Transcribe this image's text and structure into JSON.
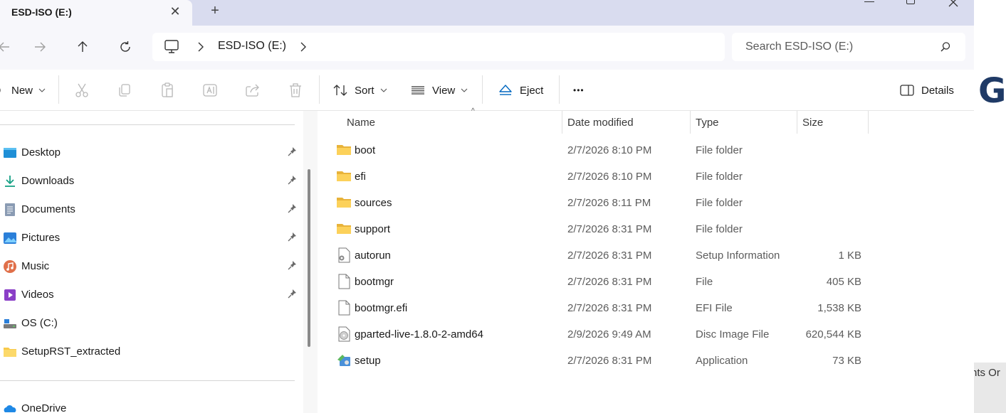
{
  "window": {
    "tab_title": "ESD-ISO (E:)",
    "tab_close": "✕",
    "new_tab": "+"
  },
  "address": {
    "crumb": "ESD-ISO (E:)"
  },
  "search": {
    "placeholder": "Search ESD-ISO (E:)"
  },
  "commands": {
    "new_label": "New",
    "sort_label": "Sort",
    "view_label": "View",
    "eject_label": "Eject",
    "more_label": "•••",
    "details_label": "Details"
  },
  "sidebar": {
    "items": [
      {
        "label": "Desktop",
        "icon": "desktop-icon"
      },
      {
        "label": "Downloads",
        "icon": "downloads-icon"
      },
      {
        "label": "Documents",
        "icon": "documents-icon"
      },
      {
        "label": "Pictures",
        "icon": "pictures-icon"
      },
      {
        "label": "Music",
        "icon": "music-icon"
      },
      {
        "label": "Videos",
        "icon": "videos-icon"
      },
      {
        "label": "OS (C:)",
        "icon": "drive-icon"
      },
      {
        "label": "SetupRST_extracted",
        "icon": "folder-icon"
      },
      {
        "label": "OneDrive",
        "icon": "onedrive-icon"
      }
    ]
  },
  "columns": {
    "name": "Name",
    "date": "Date modified",
    "type": "Type",
    "size": "Size"
  },
  "files": [
    {
      "name": "boot",
      "date": "2/7/2026 8:10 PM",
      "type": "File folder",
      "size": "",
      "icon": "folder-icon"
    },
    {
      "name": "efi",
      "date": "2/7/2026 8:10 PM",
      "type": "File folder",
      "size": "",
      "icon": "folder-icon"
    },
    {
      "name": "sources",
      "date": "2/7/2026 8:11 PM",
      "type": "File folder",
      "size": "",
      "icon": "folder-icon"
    },
    {
      "name": "support",
      "date": "2/7/2026 8:31 PM",
      "type": "File folder",
      "size": "",
      "icon": "folder-icon"
    },
    {
      "name": "autorun",
      "date": "2/7/2026 8:31 PM",
      "type": "Setup Information",
      "size": "1 KB",
      "icon": "setup-info-icon"
    },
    {
      "name": "bootmgr",
      "date": "2/7/2026 8:31 PM",
      "type": "File",
      "size": "405 KB",
      "icon": "file-icon"
    },
    {
      "name": "bootmgr.efi",
      "date": "2/7/2026 8:31 PM",
      "type": "EFI File",
      "size": "1,538 KB",
      "icon": "file-icon"
    },
    {
      "name": "gparted-live-1.8.0-2-amd64",
      "date": "2/9/2026 9:49 AM",
      "type": "Disc Image File",
      "size": "620,544 KB",
      "icon": "disc-image-icon"
    },
    {
      "name": "setup",
      "date": "2/7/2026 8:31 PM",
      "type": "Application",
      "size": "73 KB",
      "icon": "setup-app-icon"
    }
  ],
  "background_app": {
    "big_text": "GE",
    "small_text": "nts Or"
  },
  "colors": {
    "folder": "#f8c94a",
    "accent": "#0067c0",
    "titlebar": "#d9dcef"
  }
}
